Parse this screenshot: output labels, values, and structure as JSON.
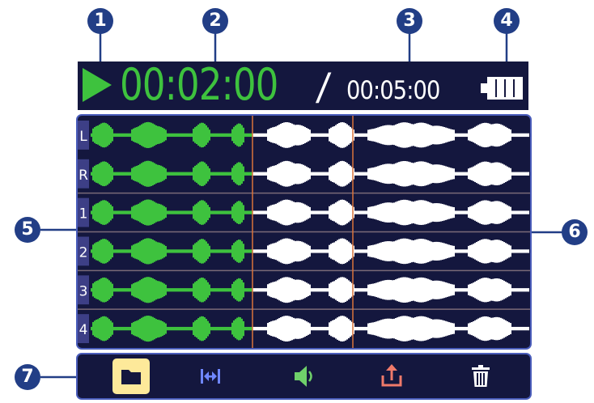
{
  "status": {
    "elapsed_time": "00:02:00",
    "separator": "/",
    "total_time": "00:05:00",
    "play_icon": "play-triangle-icon",
    "battery_icon": "battery-full-icon"
  },
  "tracks": [
    {
      "label": "L"
    },
    {
      "label": "R"
    },
    {
      "label": "1"
    },
    {
      "label": "2"
    },
    {
      "label": "3"
    },
    {
      "label": "4"
    }
  ],
  "toolbar": {
    "buttons": [
      {
        "name": "folder",
        "icon": "folder-icon",
        "selected": true
      },
      {
        "name": "trim",
        "icon": "trim-arrows-icon",
        "selected": false
      },
      {
        "name": "volume",
        "icon": "speaker-icon",
        "selected": false
      },
      {
        "name": "export",
        "icon": "export-upload-icon",
        "selected": false
      },
      {
        "name": "delete",
        "icon": "trash-icon",
        "selected": false
      }
    ]
  },
  "callouts": [
    "1",
    "2",
    "3",
    "4",
    "5",
    "6",
    "7"
  ],
  "colors": {
    "background": "#14173e",
    "played_wave": "#3ec23e",
    "unplayed_wave": "#ffffff",
    "elapsed_time": "#3ec23e",
    "marker_line": "#d9733a",
    "frame_border": "#4a5dbb",
    "callout_fill": "#223e86",
    "selected_button": "#fde99a",
    "export_icon": "#f07a6a"
  }
}
